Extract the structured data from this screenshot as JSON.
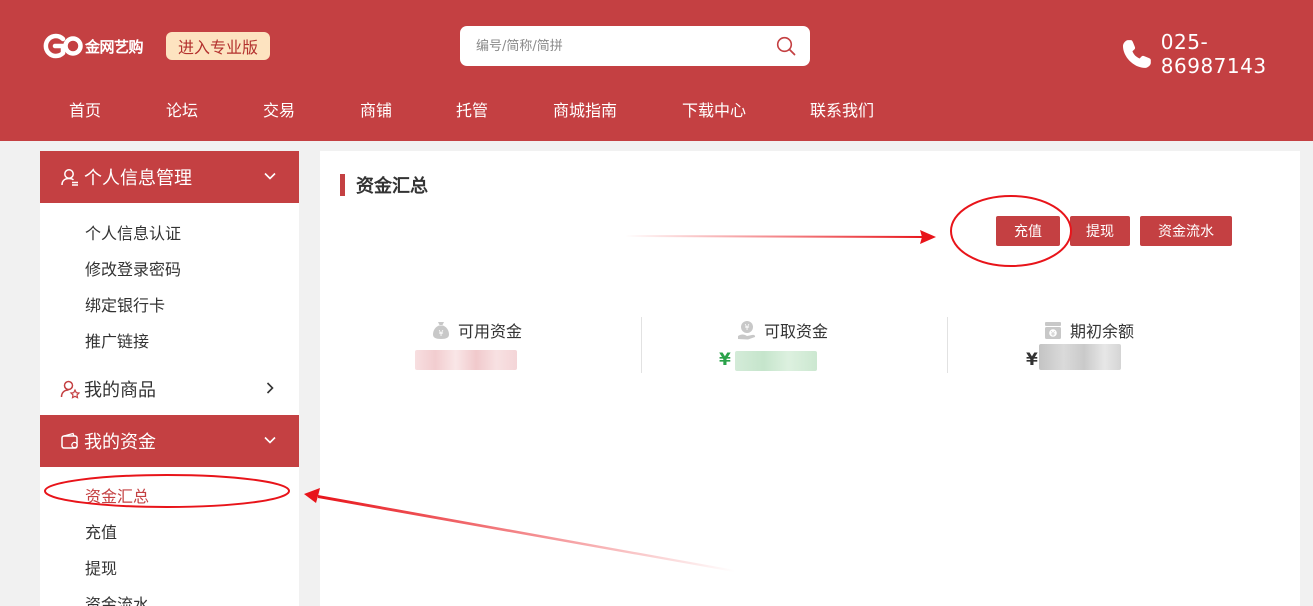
{
  "header": {
    "logo_text": "金网艺购",
    "pro_button": "进入专业版",
    "search_placeholder": "编号/简称/简拼",
    "phone": "025-86987143"
  },
  "nav": [
    {
      "label": "首页"
    },
    {
      "label": "论坛"
    },
    {
      "label": "交易"
    },
    {
      "label": "商铺"
    },
    {
      "label": "托管"
    },
    {
      "label": "商城指南"
    },
    {
      "label": "下载中心"
    },
    {
      "label": "联系我们"
    }
  ],
  "sidebar": {
    "personal": {
      "title": "个人信息管理",
      "items": [
        "个人信息认证",
        "修改登录密码",
        "绑定银行卡",
        "推广链接"
      ]
    },
    "goods": {
      "title": "我的商品"
    },
    "funds": {
      "title": "我的资金",
      "items": [
        "资金汇总",
        "充值",
        "提现",
        "资金流水"
      ]
    }
  },
  "main": {
    "title": "资金汇总",
    "buttons": {
      "recharge": "充值",
      "withdraw": "提现",
      "flow": "资金流水"
    },
    "stats": {
      "available": {
        "label": "可用资金"
      },
      "withdrawable": {
        "label": "可取资金",
        "currency": "¥"
      },
      "opening": {
        "label": "期初余额",
        "currency": "¥"
      }
    }
  },
  "colors": {
    "brand": "#c44042",
    "pro_button_bg": "#fde3c0",
    "money_green": "#2aa24a",
    "annotation_red": "#e8141a"
  }
}
